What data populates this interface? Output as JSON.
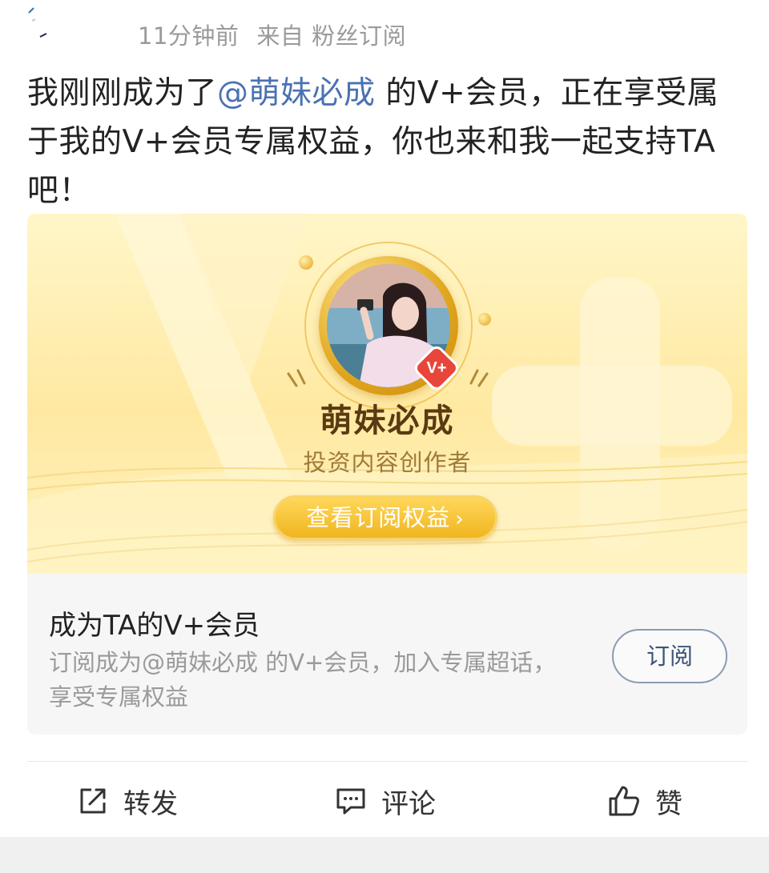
{
  "post": {
    "time": "11分钟前",
    "source": "来自 粉丝订阅",
    "text_before": "我刚刚成为了",
    "mention": "@萌妹必成",
    "text_after": " 的V+会员，正在享受属于我的V+会员专属权益，你也来和我一起支持TA吧！"
  },
  "card": {
    "creator_name": "萌妹必成",
    "creator_role": "投资内容创作者",
    "badge_text": "V+",
    "view_button_label": "查看订阅权益",
    "view_button_chevron": "›",
    "join_title": "成为TA的V+会员",
    "join_desc": "订阅成为@萌妹必成 的V+会员，加入专属超话，享受专属权益",
    "subscribe_label": "订阅"
  },
  "actions": {
    "forward_label": "转发",
    "comment_label": "评论",
    "like_label": "赞"
  },
  "colors": {
    "mention": "#4a72b3",
    "gold": "#f0b520",
    "creator_name": "#5a3a12",
    "muted": "#9a9a9a"
  },
  "icons": {
    "forward": "share-arrow-icon",
    "comment": "comment-bubble-icon",
    "like": "thumbs-up-icon",
    "badge": "vplus-badge-icon"
  }
}
